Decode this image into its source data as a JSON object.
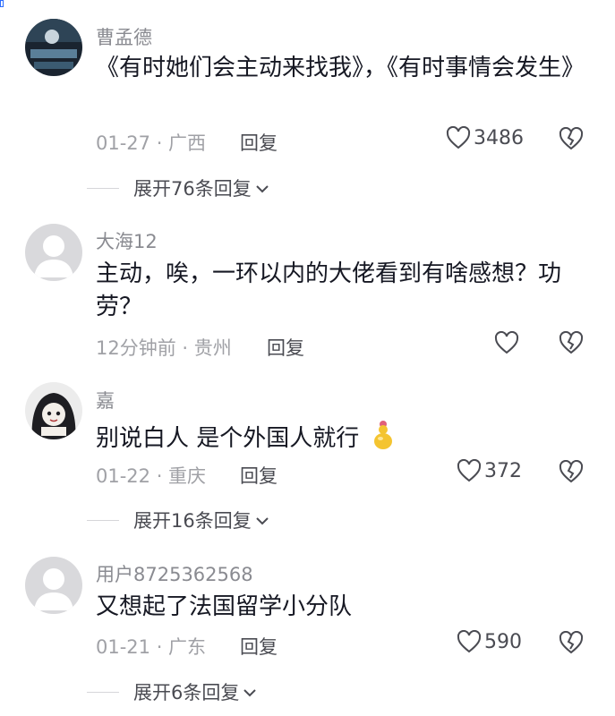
{
  "comments": [
    {
      "username": "曹孟德",
      "text": "《有时她们会主动来找我》，《有时事情会发生》",
      "meta": "01-27 · 广西",
      "reply": "回复",
      "likes": "3486",
      "expand": "展开76条回复"
    },
    {
      "username": "大海12",
      "text": "主动，唉，一环以内的大佬看到有啥感想？功劳？",
      "meta": "12分钟前 · 贵州",
      "reply": "回复",
      "likes": ""
    },
    {
      "username": "嘉",
      "text": "别说白人 是个外国人就行",
      "meta": "01-22 · 重庆",
      "reply": "回复",
      "likes": "372",
      "expand": "展开16条回复"
    },
    {
      "username": "用户8725362568",
      "text": "又想起了法国留学小分队",
      "meta": "01-21 · 广东",
      "reply": "回复",
      "likes": "590",
      "expand": "展开6条回复"
    }
  ],
  "colors": {
    "text": "#161823",
    "muted": "#a0a1a6",
    "username": "#8a8b91"
  }
}
